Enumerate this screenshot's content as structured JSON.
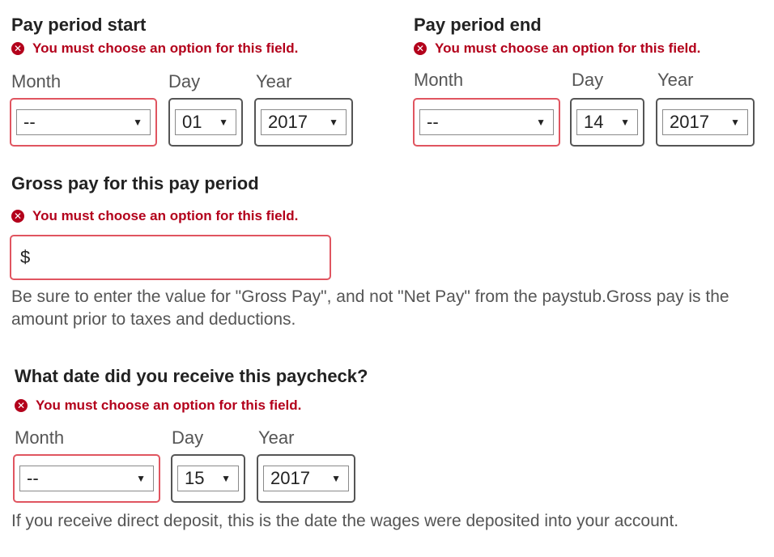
{
  "error_message": "You must choose an option for this field.",
  "error_icon": "error-circle-icon",
  "colors": {
    "error": "#b3001b",
    "invalid_border": "#e05560"
  },
  "pay_start": {
    "heading": "Pay period start",
    "month_label": "Month",
    "day_label": "Day",
    "year_label": "Year",
    "month_value": "--",
    "day_value": "01",
    "year_value": "2017"
  },
  "pay_end": {
    "heading": "Pay period end",
    "month_label": "Month",
    "day_label": "Day",
    "year_label": "Year",
    "month_value": "--",
    "day_value": "14",
    "year_value": "2017"
  },
  "gross_pay": {
    "heading": "Gross pay for this pay period",
    "currency_symbol": "$",
    "value": "",
    "help_text": "Be sure to enter the value for \"Gross Pay\", and not \"Net Pay\" from the paystub.Gross pay is the amount prior to taxes and deductions."
  },
  "paycheck_date": {
    "heading": "What date did you receive this paycheck?",
    "month_label": "Month",
    "day_label": "Day",
    "year_label": "Year",
    "month_value": "--",
    "day_value": "15",
    "year_value": "2017",
    "help_text": "If you receive direct deposit, this is the date the wages were deposited into your account."
  }
}
